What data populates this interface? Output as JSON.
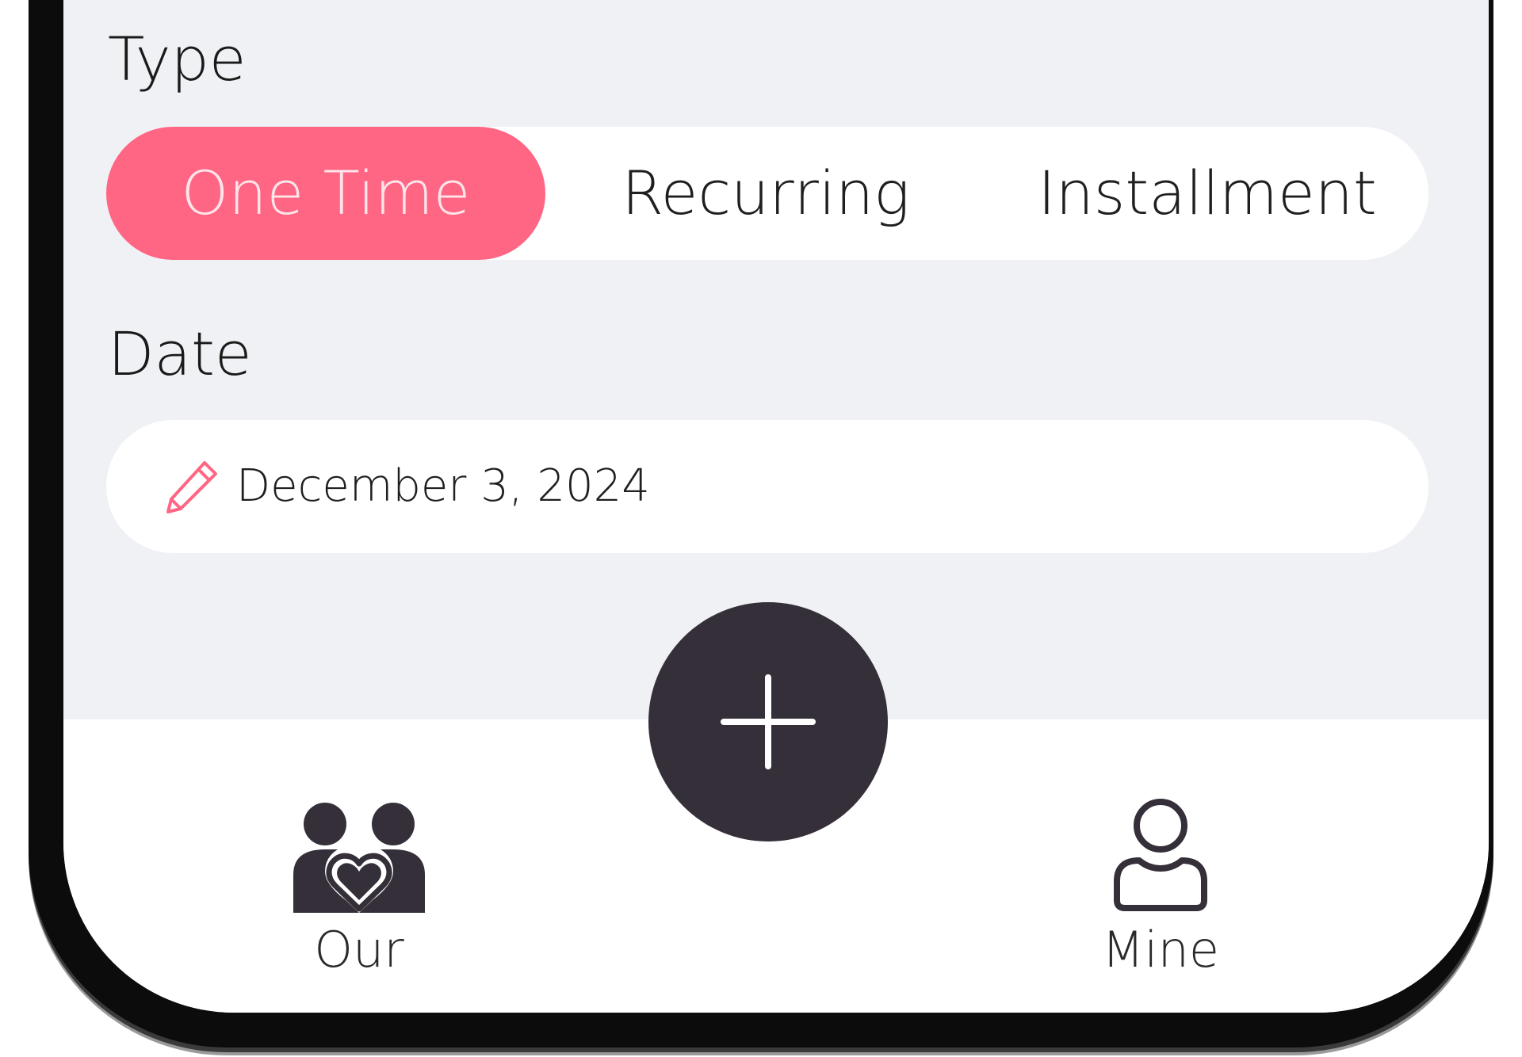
{
  "form": {
    "type_label": "Type",
    "type_options": [
      "One Time",
      "Recurring",
      "Installment"
    ],
    "type_selected": "One Time",
    "date_label": "Date",
    "date_value": "December 3, 2024"
  },
  "fab": {
    "icon": "plus-icon"
  },
  "bottom_nav": {
    "items": [
      {
        "label": "Our",
        "icon": "couple-heart-icon"
      },
      {
        "label": "Mine",
        "icon": "person-icon"
      }
    ]
  },
  "colors": {
    "accent": "#ff6684",
    "background": "#f0f1f5",
    "fab": "#352f3a",
    "surface": "#ffffff"
  }
}
